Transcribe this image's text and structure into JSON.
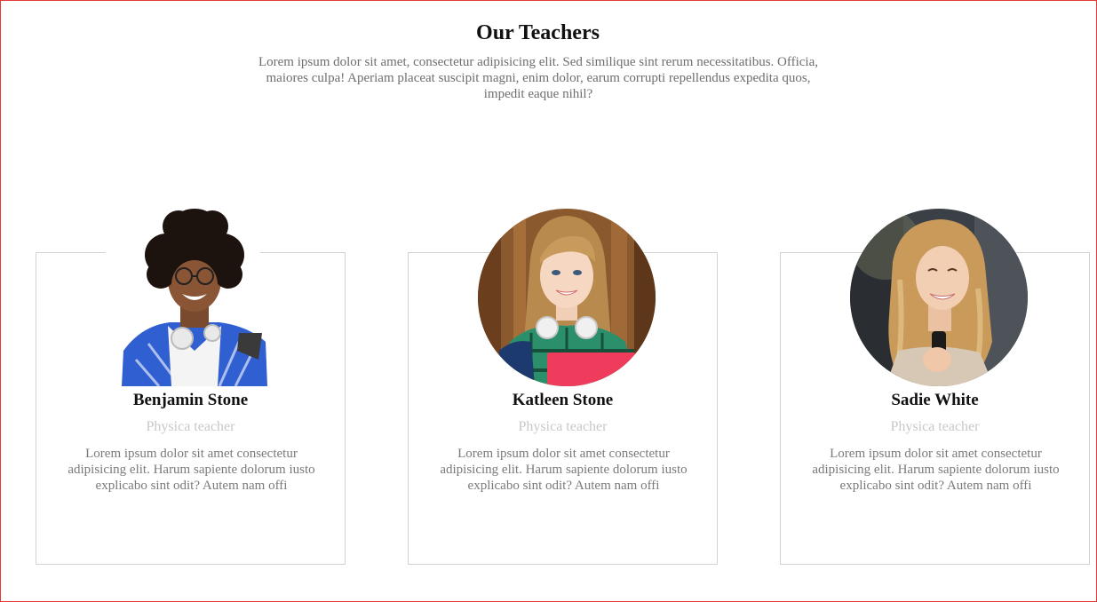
{
  "section": {
    "title": "Our Teachers",
    "intro": "Lorem ipsum dolor sit amet, consectetur adipisicing elit. Sed similique sint rerum necessitatibus. Officia, maiores culpa! Aperiam placeat suscipit magni, enim dolor, earum corrupti repellendus expedita quos, impedit eaque nihil?"
  },
  "teachers": [
    {
      "name": "Benjamin Stone",
      "role": "Physica teacher",
      "bio": "Lorem ipsum dolor sit amet consectetur adipisicing elit. Harum sapiente dolorum iusto explicabo sint odit? Autem nam offi"
    },
    {
      "name": "Katleen Stone",
      "role": "Physica teacher",
      "bio": "Lorem ipsum dolor sit amet consectetur adipisicing elit. Harum sapiente dolorum iusto explicabo sint odit? Autem nam offi"
    },
    {
      "name": "Sadie White",
      "role": "Physica teacher",
      "bio": "Lorem ipsum dolor sit amet consectetur adipisicing elit. Harum sapiente dolorum iusto explicabo sint odit? Autem nam offi"
    }
  ],
  "colors": {
    "page_border": "#e53935",
    "card_border": "#d2d2d2",
    "role_text": "#c8c8c8",
    "body_text": "#7a7a7a"
  }
}
